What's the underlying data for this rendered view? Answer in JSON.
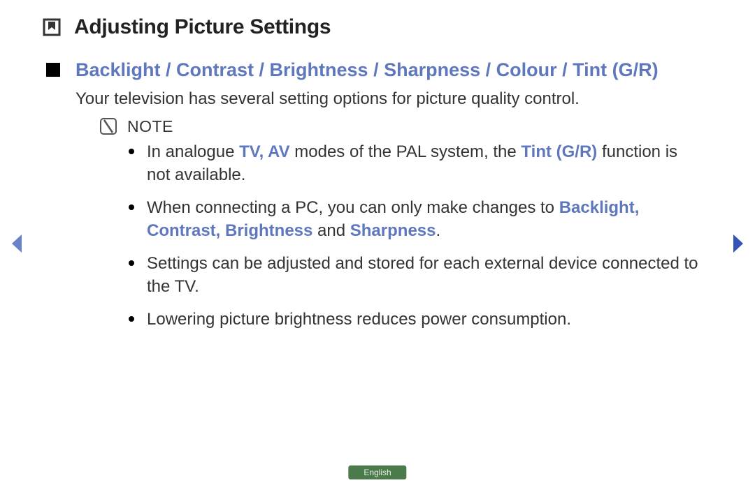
{
  "title": "Adjusting Picture Settings",
  "section_heading": "Backlight / Contrast / Brightness / Sharpness / Colour / Tint (G/R)",
  "intro": "Your television has several setting options for picture quality control.",
  "note_label": "NOTE",
  "bullets": {
    "b1a": "In analogue ",
    "b1b": "TV, AV",
    "b1c": " modes of the PAL system, the ",
    "b1d": "Tint (G/R)",
    "b1e": " function is not available.",
    "b2a": "When connecting a PC, you can only make changes to ",
    "b2b": "Backlight, Contrast, Brightness",
    "b2c": " and ",
    "b2d": "Sharpness",
    "b2e": ".",
    "b3": "Settings can be adjusted and stored for each external device connected to the TV.",
    "b4": "Lowering picture brightness reduces power consumption."
  },
  "language": "English"
}
